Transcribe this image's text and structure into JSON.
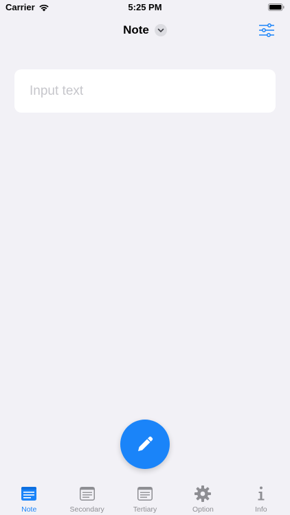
{
  "status_bar": {
    "carrier": "Carrier",
    "time": "5:25 PM"
  },
  "nav": {
    "title": "Note"
  },
  "input": {
    "placeholder": "Input text",
    "value": ""
  },
  "tabs": [
    {
      "label": "Note",
      "icon": "note-icon",
      "active": true
    },
    {
      "label": "Secondary",
      "icon": "note-icon",
      "active": false
    },
    {
      "label": "Tertiary",
      "icon": "note-icon",
      "active": false
    },
    {
      "label": "Option",
      "icon": "gear-icon",
      "active": false
    },
    {
      "label": "Info",
      "icon": "info-icon",
      "active": false
    }
  ],
  "colors": {
    "accent": "#1a84f9",
    "inactive": "#8e8e93",
    "background": "#f2f1f6"
  }
}
